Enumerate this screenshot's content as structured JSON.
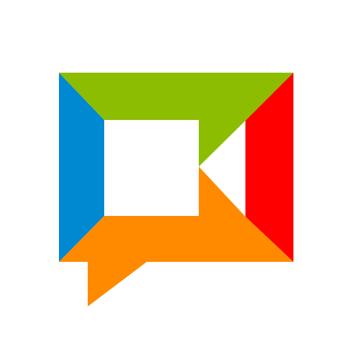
{
  "logo": {
    "icon_name": "video-chat-bubble-logo-icon",
    "colors": {
      "blue": "#0088D1",
      "green": "#8CBD00",
      "red": "#FF0000",
      "orange": "#FF8A00",
      "background": "#FFFFFF"
    }
  }
}
